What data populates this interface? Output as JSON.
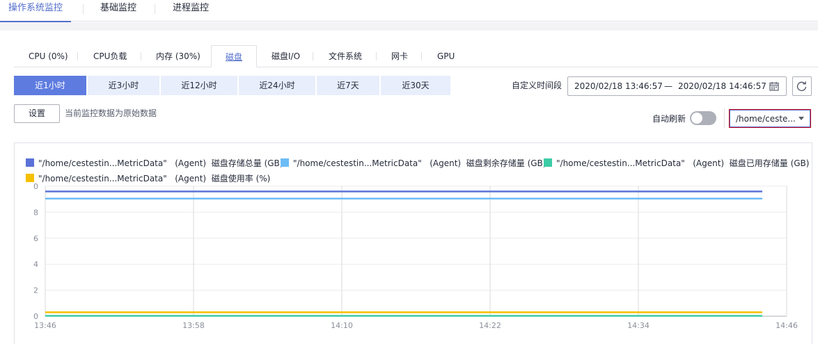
{
  "top_tabs": [
    {
      "label": "操作系统监控",
      "active": true
    },
    {
      "label": "基础监控",
      "active": false
    },
    {
      "label": "进程监控",
      "active": false
    }
  ],
  "sub_tabs": [
    {
      "label": "CPU (0%)"
    },
    {
      "label": "CPU负载"
    },
    {
      "label": "内存 (30%)"
    },
    {
      "label": "磁盘",
      "active": true
    },
    {
      "label": "磁盘I/O"
    },
    {
      "label": "文件系统"
    },
    {
      "label": "网卡"
    },
    {
      "label": "GPU"
    }
  ],
  "time_ranges": [
    {
      "label": "近1小时",
      "active": true
    },
    {
      "label": "近3小时"
    },
    {
      "label": "近12小时"
    },
    {
      "label": "近24小时"
    },
    {
      "label": "近7天"
    },
    {
      "label": "近30天"
    }
  ],
  "custom_range": {
    "label": "自定义时间段",
    "start": "2020/02/18 13:46:57",
    "separator": "—",
    "end": "2020/02/18 14:46:57"
  },
  "settings": {
    "button_label": "设置",
    "hint": "当前监控数据为原始数据"
  },
  "auto_refresh": {
    "label": "自动刷新",
    "enabled": false
  },
  "directory_select": {
    "value": "/home/ceste..."
  },
  "colors": {
    "accent": "#5e7ce0",
    "series_total": "#5b72d8",
    "series_free": "#6cbcf5",
    "series_used": "#3dcca6",
    "series_usage": "#f5c000"
  },
  "legend": [
    {
      "path": "\"/home/cestestin...MetricData\"",
      "source": "(Agent)",
      "metric": "磁盘存储总量 (GB)",
      "color": "#5b72d8"
    },
    {
      "path": "\"/home/cestestin...MetricData\"",
      "source": "(Agent)",
      "metric": "磁盘剩余存储量 (GB)",
      "color": "#6cbcf5"
    },
    {
      "path": "\"/home/cestestin...MetricData\"",
      "source": "(Agent)",
      "metric": "磁盘已用存储量 (GB)",
      "color": "#3dcca6"
    },
    {
      "path": "\"/home/cestestin...MetricData\"",
      "source": "(Agent)",
      "metric": "磁盘使用率 (%)",
      "color": "#f5c000"
    }
  ],
  "chart_data": {
    "type": "line",
    "x": [
      "13:46",
      "13:58",
      "14:10",
      "14:22",
      "14:34",
      "14:46"
    ],
    "y_ticks": [
      "0",
      "2",
      "4",
      "6",
      "8",
      "0"
    ],
    "ylim": [
      0,
      10
    ],
    "grid": true,
    "legend_position": "top",
    "series": [
      {
        "name": "\"/home/cestestin...MetricData\" (Agent) 磁盘存储总量 (GB)",
        "color": "#5b72d8",
        "values": [
          9.6,
          9.6,
          9.6,
          9.6,
          9.6,
          9.6
        ]
      },
      {
        "name": "\"/home/cestestin...MetricData\" (Agent) 磁盘剩余存储量 (GB)",
        "color": "#6cbcf5",
        "values": [
          9.05,
          9.05,
          9.05,
          9.05,
          9.05,
          9.05
        ]
      },
      {
        "name": "\"/home/cestestin...MetricData\" (Agent) 磁盘已用存储量 (GB)",
        "color": "#3dcca6",
        "values": [
          0.03,
          0.03,
          0.03,
          0.03,
          0.03,
          0.03
        ]
      },
      {
        "name": "\"/home/cestestin...MetricData\" (Agent) 磁盘使用率 (%)",
        "color": "#f5c000",
        "values": [
          0.3,
          0.3,
          0.3,
          0.3,
          0.3,
          0.3
        ]
      }
    ]
  }
}
